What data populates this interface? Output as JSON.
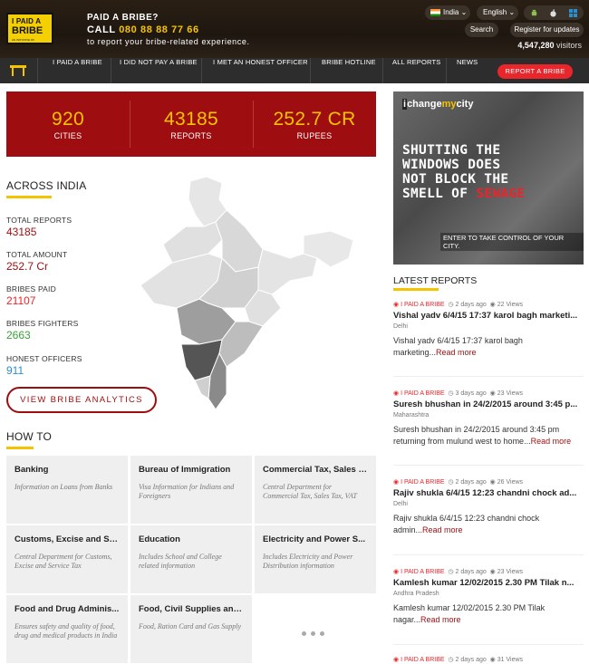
{
  "header": {
    "logo": {
      "line1": "I PAID A",
      "line2": "BRIBE",
      "tagline": "AN INITIATIVE OF JANAAGRAHA"
    },
    "question": "PAID A BRIBE?",
    "call_label": "CALL",
    "call_number": "080 88 88 77 66",
    "subtitle": "to report your bribe-related experience.",
    "country": "India",
    "language": "English",
    "search": "Search",
    "register": "Register for updates",
    "visitors_count": "4,547,280",
    "visitors_label": "visitors"
  },
  "nav": {
    "items": [
      "I PAID A BRIBE",
      "I DID NOT PAY A BRIBE",
      "I MET AN HONEST OFFICER",
      "BRIBE HOTLINE",
      "ALL REPORTS",
      "NEWS"
    ],
    "report_button": "REPORT A BRIBE"
  },
  "stats": [
    {
      "value": "920",
      "label": "CITIES"
    },
    {
      "value": "43185",
      "label": "REPORTS"
    },
    {
      "value": "252.7 CR",
      "label": "RUPEES"
    }
  ],
  "across_india": {
    "title": "ACROSS INDIA",
    "metrics": [
      {
        "label": "TOTAL REPORTS",
        "value": "43185",
        "color": "#9e0d10"
      },
      {
        "label": "TOTAL AMOUNT",
        "value": "252.7 Cr",
        "color": "#9e0d10"
      },
      {
        "label": "BRIBES PAID",
        "value": "21107",
        "color": "#e8262b"
      },
      {
        "label": "BRIBES FIGHTERS",
        "value": "2663",
        "color": "#3aa13a"
      },
      {
        "label": "HONEST OFFICERS",
        "value": "911",
        "color": "#2a8fd0"
      }
    ],
    "analytics_button": "VIEW BRIBE ANALYTICS"
  },
  "how_to": {
    "title": "HOW TO",
    "tiles": [
      {
        "title": "Banking",
        "desc": "Information on Loans from Banks"
      },
      {
        "title": "Bureau of Immigration",
        "desc": "Visa Information for Indians and Foreigners"
      },
      {
        "title": "Commercial Tax, Sales T...",
        "desc": "Central Department for Commercial Tax, Sales Tax, VAT"
      },
      {
        "title": "Customs, Excise and Se...",
        "desc": "Central Department for Customs, Excise and Service Tax"
      },
      {
        "title": "Education",
        "desc": "Includes School and College related information"
      },
      {
        "title": "Electricity and Power S...",
        "desc": "Includes Electricity and Power Distribution information"
      },
      {
        "title": "Food and Drug Adminis...",
        "desc": "Ensures safety and quality of food, drug and medical products in India"
      },
      {
        "title": "Food, Civil Supplies and...",
        "desc": "Food, Ration Card and Gas Supply"
      }
    ]
  },
  "ad": {
    "brand_pre": "i",
    "brand_mid": "change",
    "brand_my": "my",
    "brand_post": "city",
    "line1": "SHUTTING THE",
    "line2": "WINDOWS DOES",
    "line3": "NOT BLOCK THE",
    "line4_pre": "SMELL OF",
    "line4_hl": "SEWAGE",
    "cta": "ENTER TO TAKE CONTROL OF YOUR CITY."
  },
  "latest": {
    "title": "LATEST REPORTS",
    "reports": [
      {
        "category": "I PAID A BRIBE",
        "time": "2 days ago",
        "views": "22 Views",
        "title": "Vishal yadv 6/4/15 17:37 karol bagh marketi...",
        "location": "Delhi",
        "body": "Vishal yadv 6/4/15 17:37 karol bagh marketing...",
        "read_more": "Read more"
      },
      {
        "category": "I PAID A BRIBE",
        "time": "3 days ago",
        "views": "23 Views",
        "title": "Suresh bhushan in 24/2/2015 around 3:45 p...",
        "location": "Maharashtra",
        "body": "Suresh bhushan in 24/2/2015 around 3:45 pm returning from mulund west to home...",
        "read_more": "Read more"
      },
      {
        "category": "I PAID A BRIBE",
        "time": "2 days ago",
        "views": "26 Views",
        "title": "Rajiv shukla 6/4/15 12:23 chandni chock ad...",
        "location": "Delhi",
        "body": "Rajiv shukla 6/4/15 12:23 chandni chock admin...",
        "read_more": "Read more"
      },
      {
        "category": "I PAID A BRIBE",
        "time": "2 days ago",
        "views": "23 Views",
        "title": "Kamlesh kumar 12/02/2015 2.30 PM Tilak n...",
        "location": "Andhra Pradesh",
        "body": "Kamlesh kumar 12/02/2015 2.30 PM Tilak nagar...",
        "read_more": "Read more"
      },
      {
        "category": "I PAID A BRIBE",
        "time": "2 days ago",
        "views": "31 Views"
      }
    ]
  }
}
